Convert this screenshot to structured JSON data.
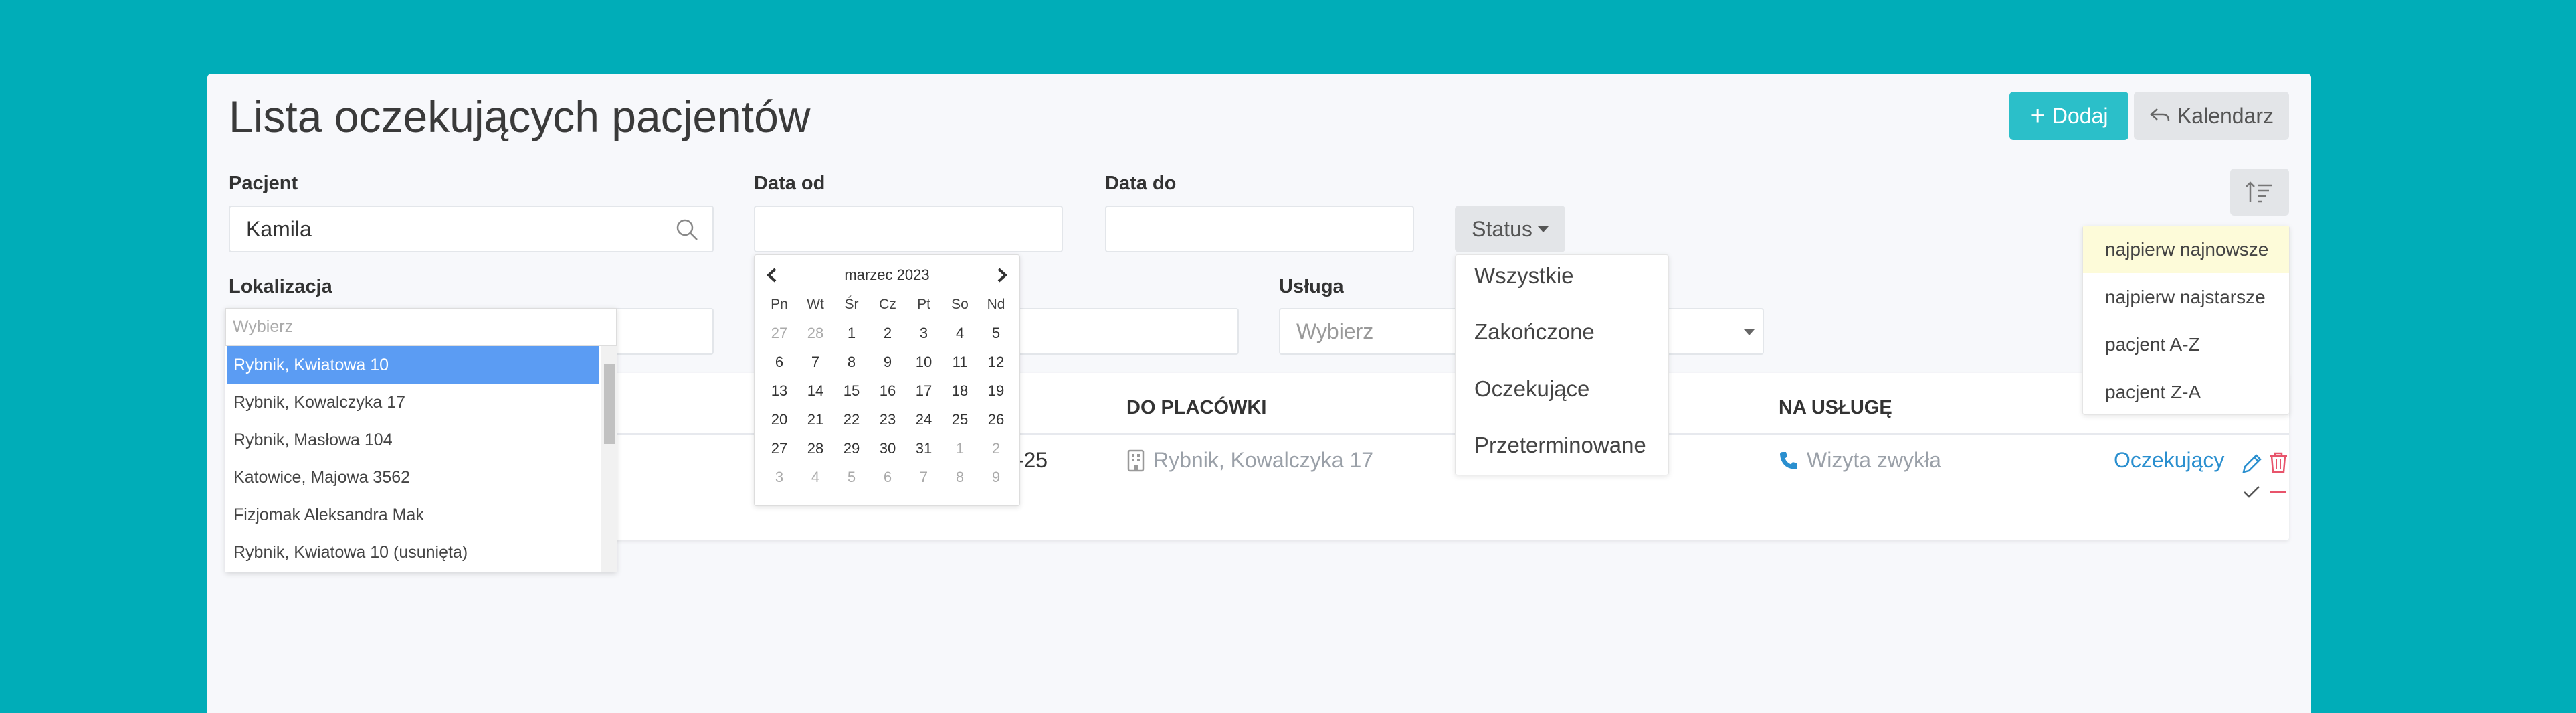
{
  "page": {
    "title": "Lista oczekujących pacjentów",
    "add_label": "Dodaj",
    "calendar_label": "Kalendarz"
  },
  "filters": {
    "patient_label": "Pacjent",
    "patient_value": "Kamila",
    "date_from_label": "Data od",
    "date_to_label": "Data do",
    "status_label": "Status",
    "location_label": "Lokalizacja",
    "location_placeholder": "Wybierz",
    "service_label": "Usługa",
    "service_placeholder": "Wybierz"
  },
  "location_dropdown": {
    "items": [
      "Rybnik, Kwiatowa 10",
      "Rybnik, Kowalczyka 17",
      "Rybnik, Masłowa 104",
      "Katowice, Majowa 3562",
      "Fizjomak Aleksandra Mak",
      "Rybnik, Kwiatowa 10 (usunięta)"
    ],
    "selected_index": 0
  },
  "datepicker": {
    "month_title": "marzec 2023",
    "weekdays": [
      "Pn",
      "Wt",
      "Śr",
      "Cz",
      "Pt",
      "So",
      "Nd"
    ],
    "days": [
      [
        "27",
        "28",
        "1",
        "2",
        "3",
        "4",
        "5"
      ],
      [
        "6",
        "7",
        "8",
        "9",
        "10",
        "11",
        "12"
      ],
      [
        "13",
        "14",
        "15",
        "16",
        "17",
        "18",
        "19"
      ],
      [
        "20",
        "21",
        "22",
        "23",
        "24",
        "25",
        "26"
      ],
      [
        "27",
        "28",
        "29",
        "30",
        "31",
        "1",
        "2"
      ],
      [
        "3",
        "4",
        "5",
        "6",
        "7",
        "8",
        "9"
      ]
    ]
  },
  "status_dropdown": {
    "items": [
      "Wszystkie",
      "Zakończone",
      "Oczekujące",
      "Przeterminowane"
    ]
  },
  "sort_dropdown": {
    "items": [
      "najpierw najnowsze",
      "najpierw najstarsze",
      "pacjent A-Z",
      "pacjent Z-A"
    ],
    "active_index": 0
  },
  "table": {
    "headers": {
      "facility": "DO PLACÓWKI",
      "service": "NA USŁUGĘ"
    },
    "row": {
      "date_fragment": "3-25",
      "facility": "Rybnik, Kowalczyka 17",
      "service": "Wizyta zwykła",
      "status": "Oczekujący"
    }
  },
  "colors": {
    "background": "#00adb8",
    "accent": "#2bbfc9",
    "selected": "#5b9cf3",
    "link": "#2a8fcf",
    "danger": "#e8546b"
  }
}
